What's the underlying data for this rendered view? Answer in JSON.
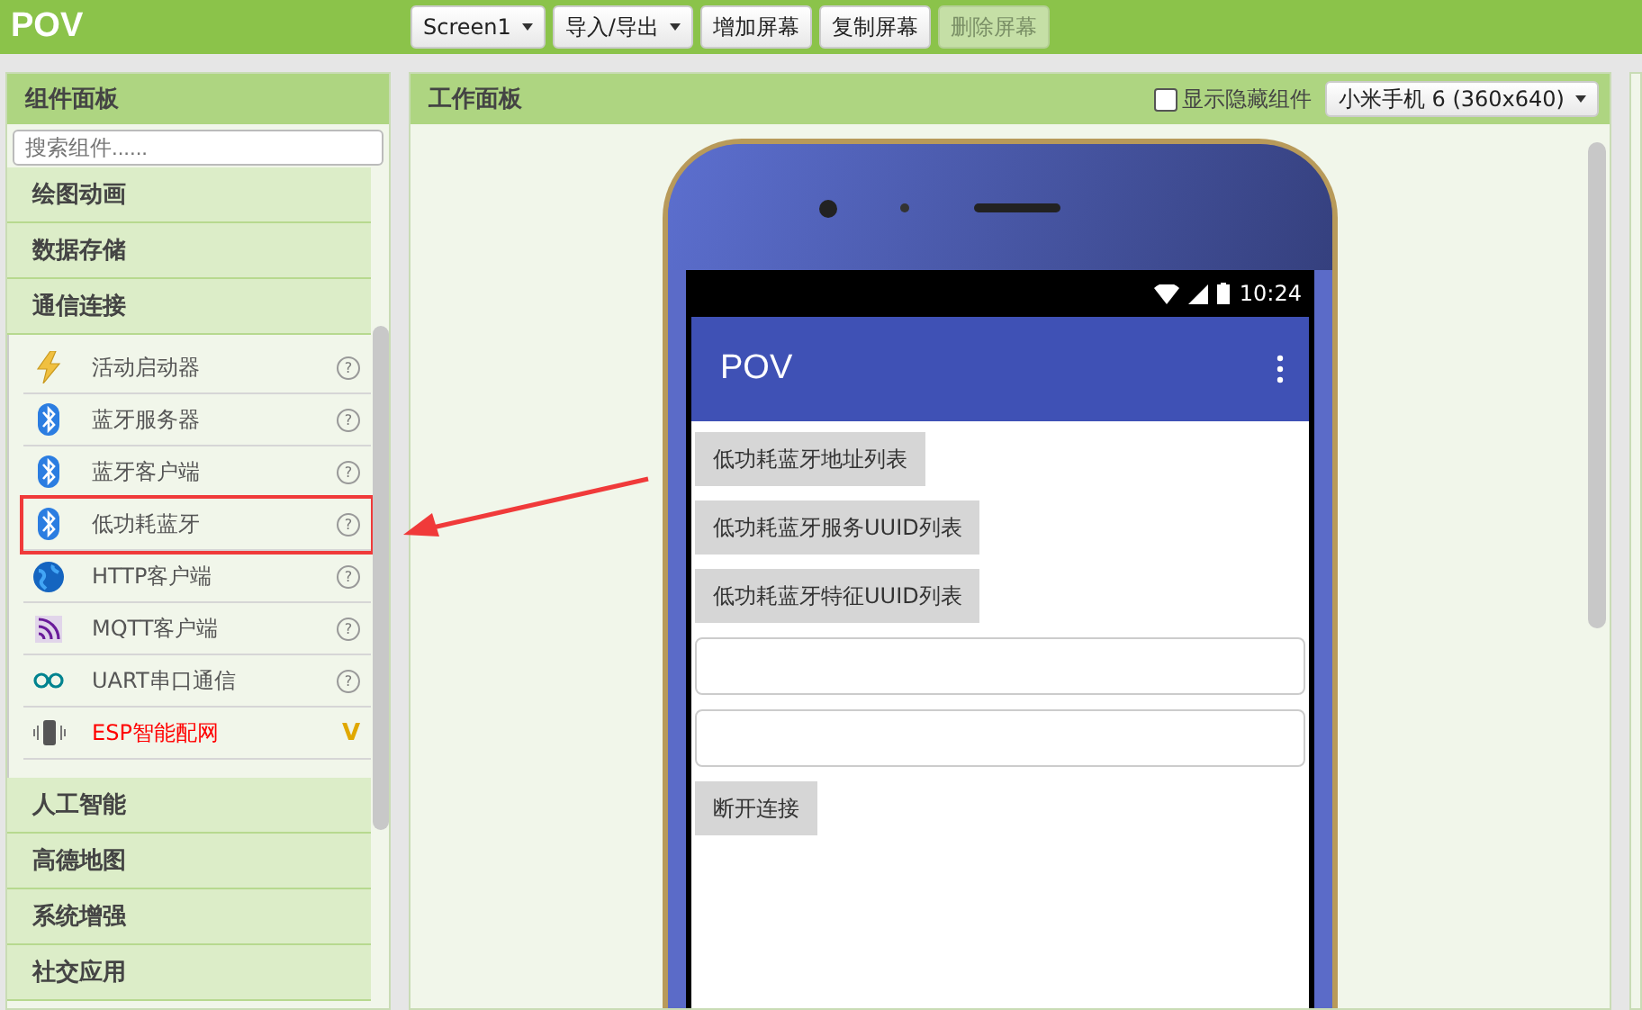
{
  "app_title": "POV",
  "toolbar": [
    {
      "label": "Screen1",
      "kind": "dropdown",
      "disabled": false
    },
    {
      "label": "导入/导出",
      "kind": "dropdown",
      "disabled": false
    },
    {
      "label": "增加屏幕",
      "kind": "button",
      "disabled": false
    },
    {
      "label": "复制屏幕",
      "kind": "button",
      "disabled": false
    },
    {
      "label": "删除屏幕",
      "kind": "button",
      "disabled": true
    }
  ],
  "palette": {
    "title": "组件面板",
    "search": {
      "placeholder": "搜索组件......"
    },
    "categories": [
      {
        "label": "绘图动画"
      },
      {
        "label": "数据存储"
      },
      {
        "label": "通信连接",
        "items": [
          {
            "label": "活动启动器",
            "kind": "trigger",
            "mark": "?",
            "extension": false,
            "highlighted": false
          },
          {
            "label": "蓝牙服务器",
            "kind": "bluetooth",
            "mark": "?",
            "extension": false,
            "highlighted": false
          },
          {
            "label": "蓝牙客户端",
            "kind": "bluetooth",
            "mark": "?",
            "extension": false,
            "highlighted": false
          },
          {
            "label": "低功耗蓝牙",
            "kind": "bluetooth",
            "mark": "?",
            "extension": false,
            "highlighted": true
          },
          {
            "label": "HTTP客户端",
            "kind": "http",
            "mark": "?",
            "extension": false,
            "highlighted": false
          },
          {
            "label": "MQTT客户端",
            "kind": "mqtt",
            "mark": "?",
            "extension": false,
            "highlighted": false
          },
          {
            "label": "UART串口通信",
            "kind": "serial",
            "mark": "?",
            "extension": false,
            "highlighted": false
          },
          {
            "label": "ESP智能配网",
            "kind": "smartconfig",
            "mark": "V",
            "extension": true,
            "highlighted": false
          }
        ]
      },
      {
        "label": "人工智能"
      },
      {
        "label": "高德地图"
      },
      {
        "label": "系统增强"
      },
      {
        "label": "社交应用"
      }
    ]
  },
  "viewer": {
    "title": "工作面板",
    "show_hidden": {
      "label": "显示隐藏组件",
      "checked": false
    },
    "device": "小米手机 6 (360x640)",
    "phone": {
      "time": "10:24",
      "app_title": "POV",
      "components": [
        {
          "kind": "button",
          "text": "低功耗蓝牙地址列表"
        },
        {
          "kind": "button",
          "text": "低功耗蓝牙服务UUID列表"
        },
        {
          "kind": "button",
          "text": "低功耗蓝牙特征UUID列表"
        },
        {
          "kind": "textbox"
        },
        {
          "kind": "textbox"
        },
        {
          "kind": "button",
          "text": "断开连接"
        }
      ]
    }
  }
}
